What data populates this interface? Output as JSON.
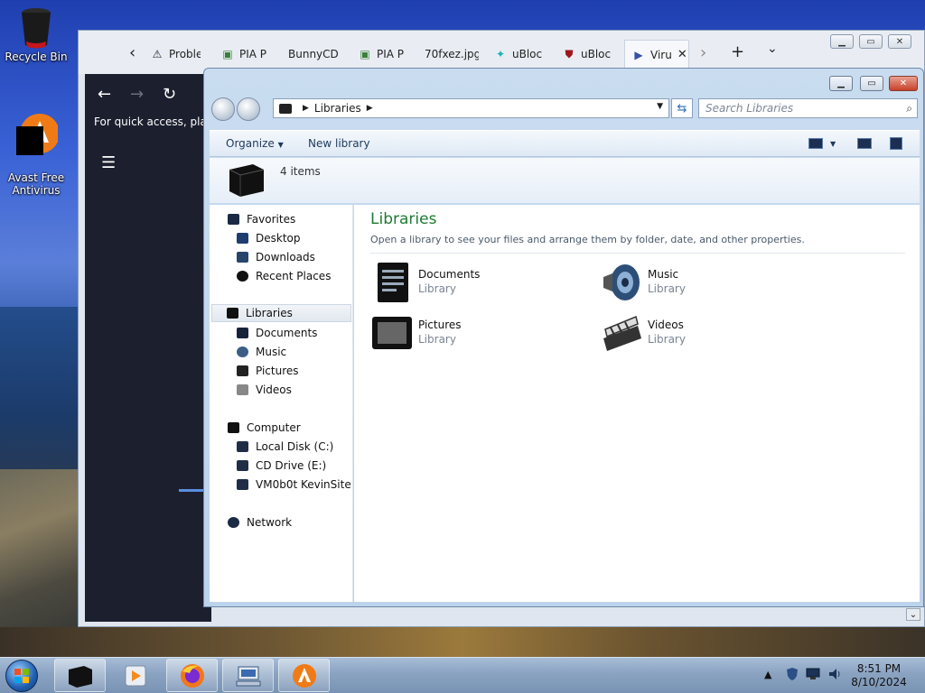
{
  "desktop": {
    "icons": [
      {
        "label": "Recycle Bin"
      },
      {
        "label": "Avast Free\nAntivirus"
      }
    ]
  },
  "browser": {
    "tabs": [
      {
        "label": "Proble",
        "icon": "warning-icon"
      },
      {
        "label": "PIA P",
        "icon": "pia-icon"
      },
      {
        "label": "BunnyCDN",
        "icon": "none"
      },
      {
        "label": "PIA P",
        "icon": "pia-icon"
      },
      {
        "label": "70fxez.jpg",
        "icon": "none"
      },
      {
        "label": "uBloc",
        "icon": "ublock-icon"
      },
      {
        "label": "uBloc",
        "icon": "ublock-icon"
      },
      {
        "label": "Viru",
        "icon": "virustotal-icon"
      }
    ],
    "hint": "For quick access, place"
  },
  "explorer": {
    "address": {
      "root": "Libraries"
    },
    "search_placeholder": "Search Libraries",
    "toolbar": {
      "organize": "Organize",
      "new_library": "New library"
    },
    "item_count": "4 items",
    "nav": {
      "favorites": "Favorites",
      "desktop": "Desktop",
      "downloads": "Downloads",
      "recent": "Recent Places",
      "libraries": "Libraries",
      "documents": "Documents",
      "music": "Music",
      "pictures": "Pictures",
      "videos": "Videos",
      "computer": "Computer",
      "local_disk": "Local Disk (C:)",
      "cd_drive": "CD Drive (E:)",
      "vm": "VM0b0t KevinSite",
      "network": "Network"
    },
    "content": {
      "title": "Libraries",
      "subtitle": "Open a library to see your files and arrange them by folder, date, and other properties.",
      "items": [
        {
          "name": "Documents",
          "type": "Library"
        },
        {
          "name": "Music",
          "type": "Library"
        },
        {
          "name": "Pictures",
          "type": "Library"
        },
        {
          "name": "Videos",
          "type": "Library"
        }
      ]
    }
  },
  "taskbar": {
    "time": "8:51 PM",
    "date": "8/10/2024"
  }
}
